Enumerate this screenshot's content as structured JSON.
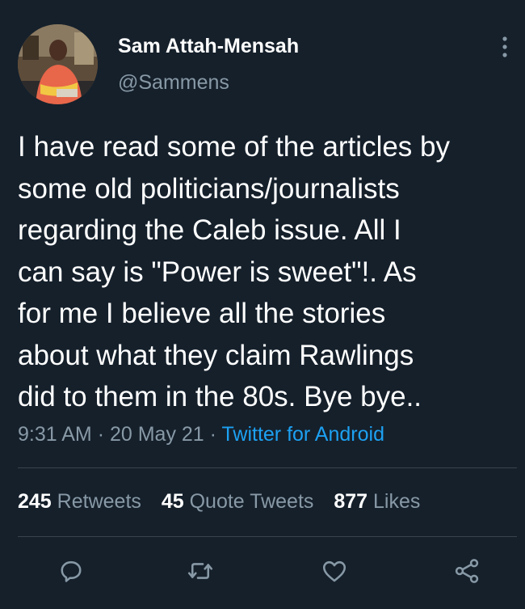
{
  "author": {
    "display_name": "Sam Attah-Mensah",
    "handle": "@Sammens"
  },
  "tweet": {
    "lines": [
      "I have read some of the articles by",
      "some old politicians/journalists",
      "regarding the Caleb issue. All I",
      "can say is \"Power is sweet\"!. As",
      "for me I believe all the stories",
      "about what they claim Rawlings",
      "did to them in the 80s. Bye bye.."
    ]
  },
  "meta": {
    "time": "9:31 AM",
    "date": "20 May 21",
    "separator": "·",
    "source": "Twitter for Android"
  },
  "stats": {
    "retweets_count": "245",
    "retweets_label": "Retweets",
    "quotes_count": "45",
    "quotes_label": "Quote Tweets",
    "likes_count": "877",
    "likes_label": "Likes"
  },
  "colors": {
    "background": "#15202b",
    "text": "#ffffff",
    "secondary": "#8899a6",
    "link": "#1da1f2",
    "divider": "#38444d"
  },
  "icons": [
    "more-vertical-icon",
    "reply-icon",
    "retweet-icon",
    "like-icon",
    "share-icon"
  ]
}
